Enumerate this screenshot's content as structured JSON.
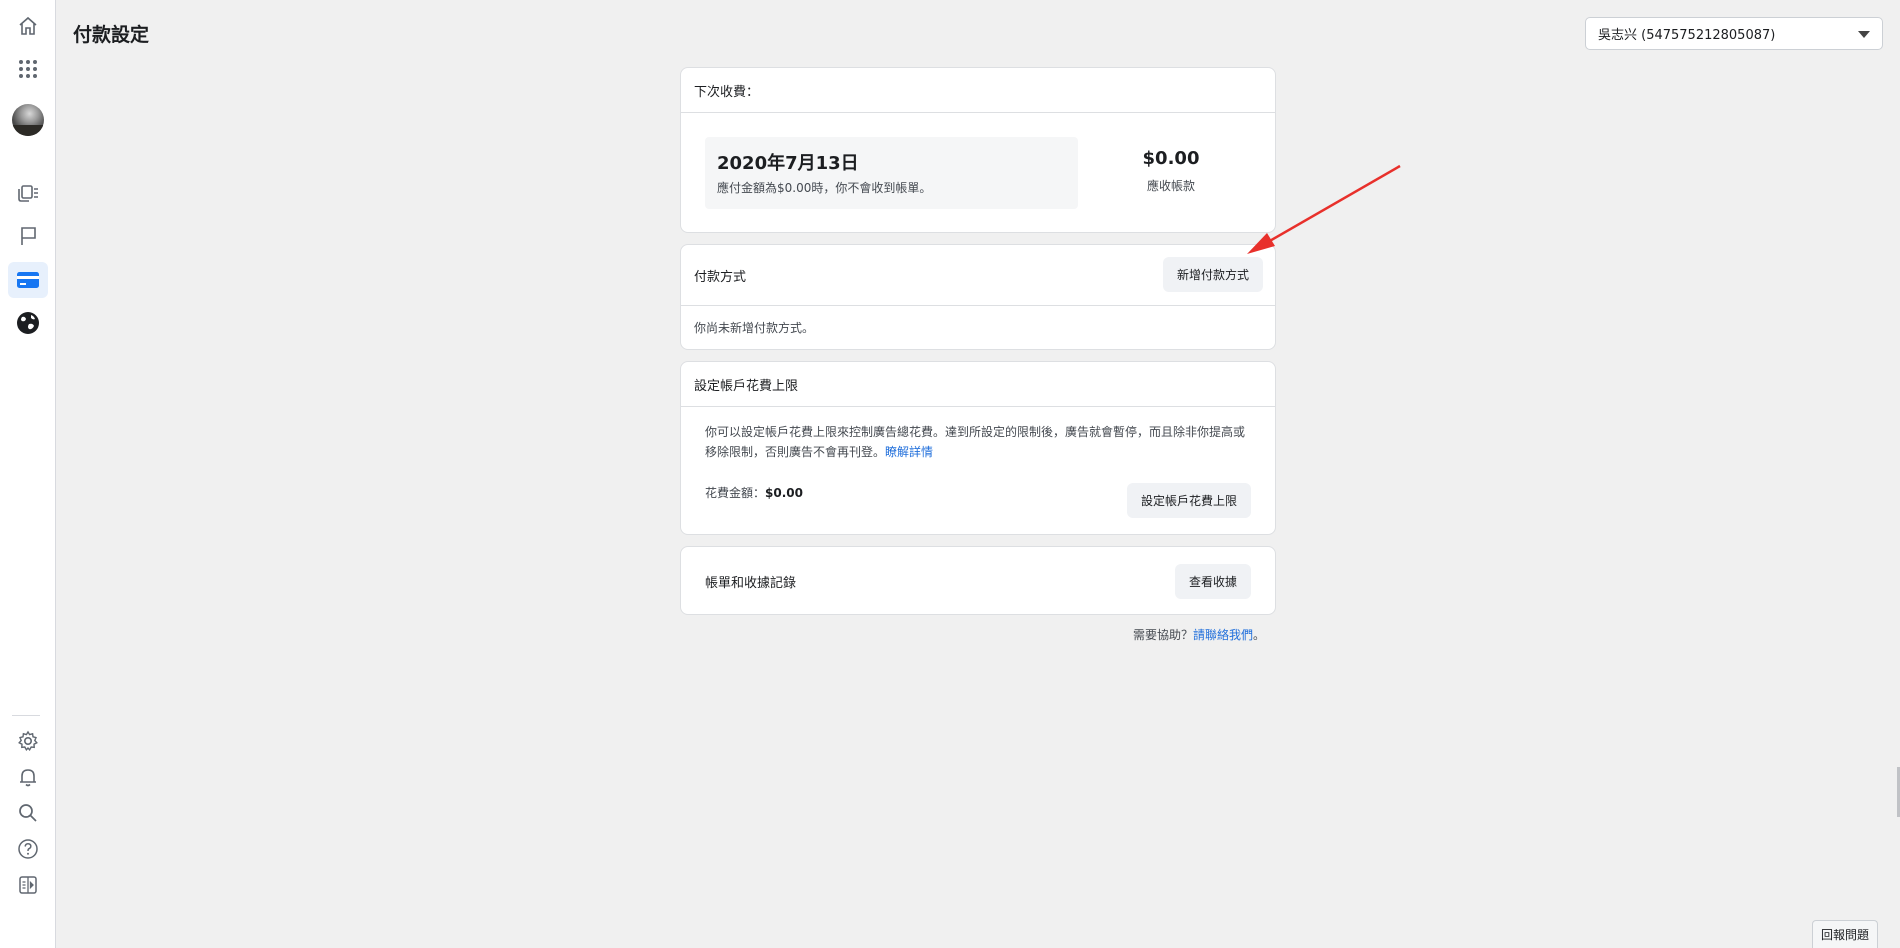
{
  "sidebar": {
    "icons": [
      "home-icon",
      "apps-grid-icon",
      "user-avatar",
      "ads-stack-icon",
      "flag-icon",
      "credit-card-icon",
      "globe-icon"
    ],
    "bottom_icons": [
      "gear-icon",
      "bell-icon",
      "search-icon",
      "help-icon",
      "panel-toggle-icon"
    ],
    "active": "credit-card-icon",
    "accent": "#1877f2"
  },
  "header": {
    "title": "付款設定",
    "account_selector": "吳志兴 (547575212805087)"
  },
  "next_charge": {
    "heading": "下次收費：",
    "date": "2020年7月13日",
    "note": "應付金額為$0.00時，你不會收到帳單。",
    "amount": "$0.00",
    "amount_label": "應收帳款"
  },
  "payment_method": {
    "heading": "付款方式",
    "add_button": "新增付款方式",
    "empty_text": "你尚未新增付款方式。"
  },
  "spending_limit": {
    "heading": "設定帳戶花費上限",
    "description": "你可以設定帳戶花費上限來控制廣告總花費。達到所設定的限制後，廣告就會暫停，而且除非你提高或移除限制，否則廣告不會再刊登。",
    "learn_more": "瞭解詳情",
    "spend_label": "花費金額：",
    "spend_value": "$0.00",
    "set_button": "設定帳戶花費上限"
  },
  "billing": {
    "title": "帳單和收據記錄",
    "view_button": "查看收據"
  },
  "help": {
    "prefix": "需要協助？",
    "link": "請聯絡我們",
    "suffix": "。"
  },
  "report_button": "回報問題",
  "annotation_arrow_color": "#e8302b"
}
